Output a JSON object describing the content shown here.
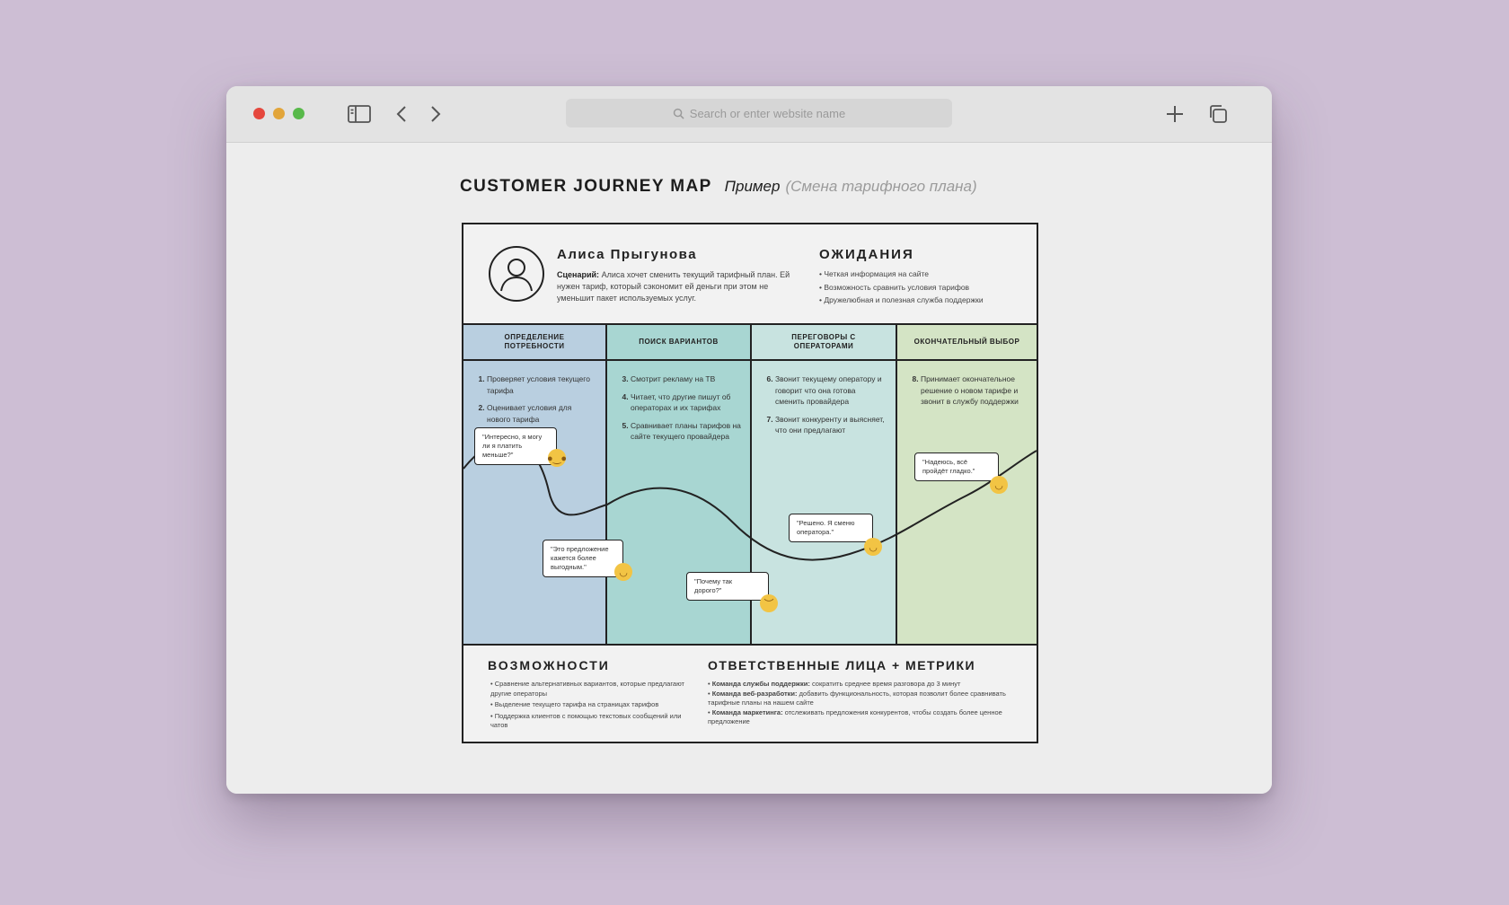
{
  "browser": {
    "url_placeholder": "Search or enter website name",
    "colors": {
      "close": "#e5473d",
      "minimize": "#e2a53a",
      "zoom": "#58b94a"
    }
  },
  "page": {
    "title": "CUSTOMER JOURNEY MAP",
    "subtitle": "Пример",
    "subtitle_note": "(Смена тарифного плана)"
  },
  "persona": {
    "name": "Алиса Прыгунова",
    "scenario_label": "Сценарий:",
    "scenario_text": "Алиса хочет сменить текущий тарифный план. Ей нужен тариф, который сэкономит ей деньги при этом не уменьшит пакет используемых услуг."
  },
  "expectations": {
    "title": "ОЖИДАНИЯ",
    "items": [
      "Четкая информация на сайте",
      "Возможность сравнить условия тарифов",
      "Дружелюбная и полезная служба поддержки"
    ]
  },
  "stages": [
    {
      "title": "ОПРЕДЕЛЕНИЕ ПОТРЕБНОСТИ",
      "color": "#b9cfe0",
      "start": 1,
      "steps": [
        "Проверяет условия текущего тарифа",
        "Оценивает условия для нового тарифа"
      ]
    },
    {
      "title": "ПОИСК ВАРИАНТОВ",
      "color": "#a8d6d2",
      "start": 3,
      "steps": [
        "Смотрит рекламу на ТВ",
        "Читает, что другие пишут об операторах и их тарифах",
        "Сравнивает планы тарифов на сайте текущего провайдера"
      ]
    },
    {
      "title": "ПЕРЕГОВОРЫ С ОПЕРАТОРАМИ",
      "color": "#c8e3e0",
      "start": 6,
      "steps": [
        "Звонит текущему оператору и говорит что она готова сменить провайдера",
        "Звонит конкуренту и выясняет, что они предлагают"
      ]
    },
    {
      "title": "ОКОНЧАТЕЛЬНЫЙ ВЫБОР",
      "color": "#d4e4c5",
      "start": 8,
      "steps": [
        "Принимает окончательное решение о новом тарифе и звонит в службу поддержки"
      ]
    }
  ],
  "quotes": [
    {
      "text": "\"Интересно, я могу ли я платить меньше?\"",
      "emoji": "thinking-face-icon"
    },
    {
      "text": "\"Это предложение кажется более выгодным.\"",
      "emoji": "smiling-face-icon"
    },
    {
      "text": "\"Почему так дорого?\"",
      "emoji": "frowning-face-icon"
    },
    {
      "text": "\"Решено. Я сменю оператора.\"",
      "emoji": "grinning-face-icon"
    },
    {
      "text": "\"Надеюсь, всё пройдёт гладко.\"",
      "emoji": "smiling-face-icon"
    }
  ],
  "opportunities": {
    "title": "ВОЗМОЖНОСТИ",
    "items": [
      "Сравнение альтернативных вариантов, которые предлагают другие операторы",
      "Выделение текущего тарифа на страницах тарифов",
      "Поддержка клиентов с помощью текстовых сообщений или чатов"
    ]
  },
  "responsibles": {
    "title": "ОТВЕТСТВЕННЫЕ ЛИЦА + МЕТРИКИ",
    "items": [
      {
        "label": "Команда службы поддержки:",
        "text": "сократить среднее время разговора до 3 минут"
      },
      {
        "label": "Команда веб-разработки:",
        "text": "добавить функциональность, которая позволит более сравнивать тарифные планы на нашем сайте"
      },
      {
        "label": "Команда маркетинга:",
        "text": "отслеживать предложения конкурентов, чтобы создать более ценное предложение"
      }
    ]
  }
}
